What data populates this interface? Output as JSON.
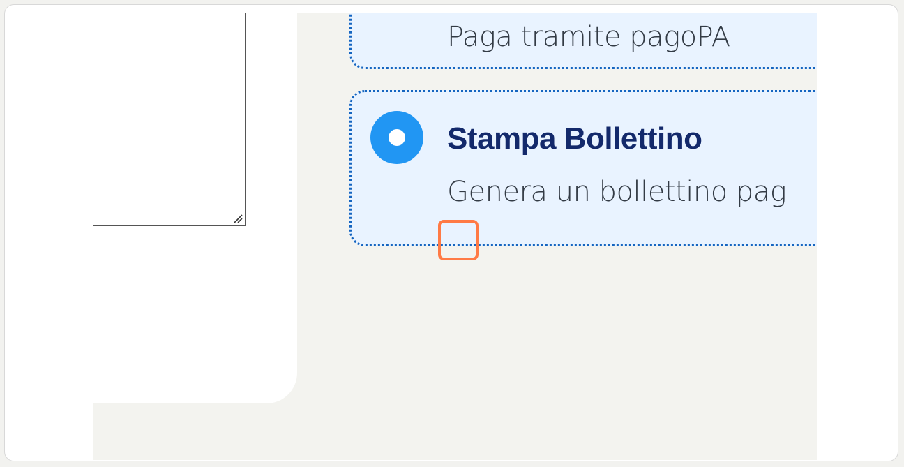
{
  "payment_options": [
    {
      "description": "Paga tramite pagoPA"
    },
    {
      "title": "Stampa Bollettino",
      "description": "Genera un bollettino pag",
      "selected": true
    }
  ],
  "colors": {
    "card_border": "#1565c0",
    "card_background": "#e9f3ff",
    "radio_selected": "#2196f3",
    "title_text": "#13296b",
    "highlight": "#ff7a45"
  },
  "icons": {
    "radio": "radio-selected-icon",
    "resize": "resize-grip-icon"
  }
}
